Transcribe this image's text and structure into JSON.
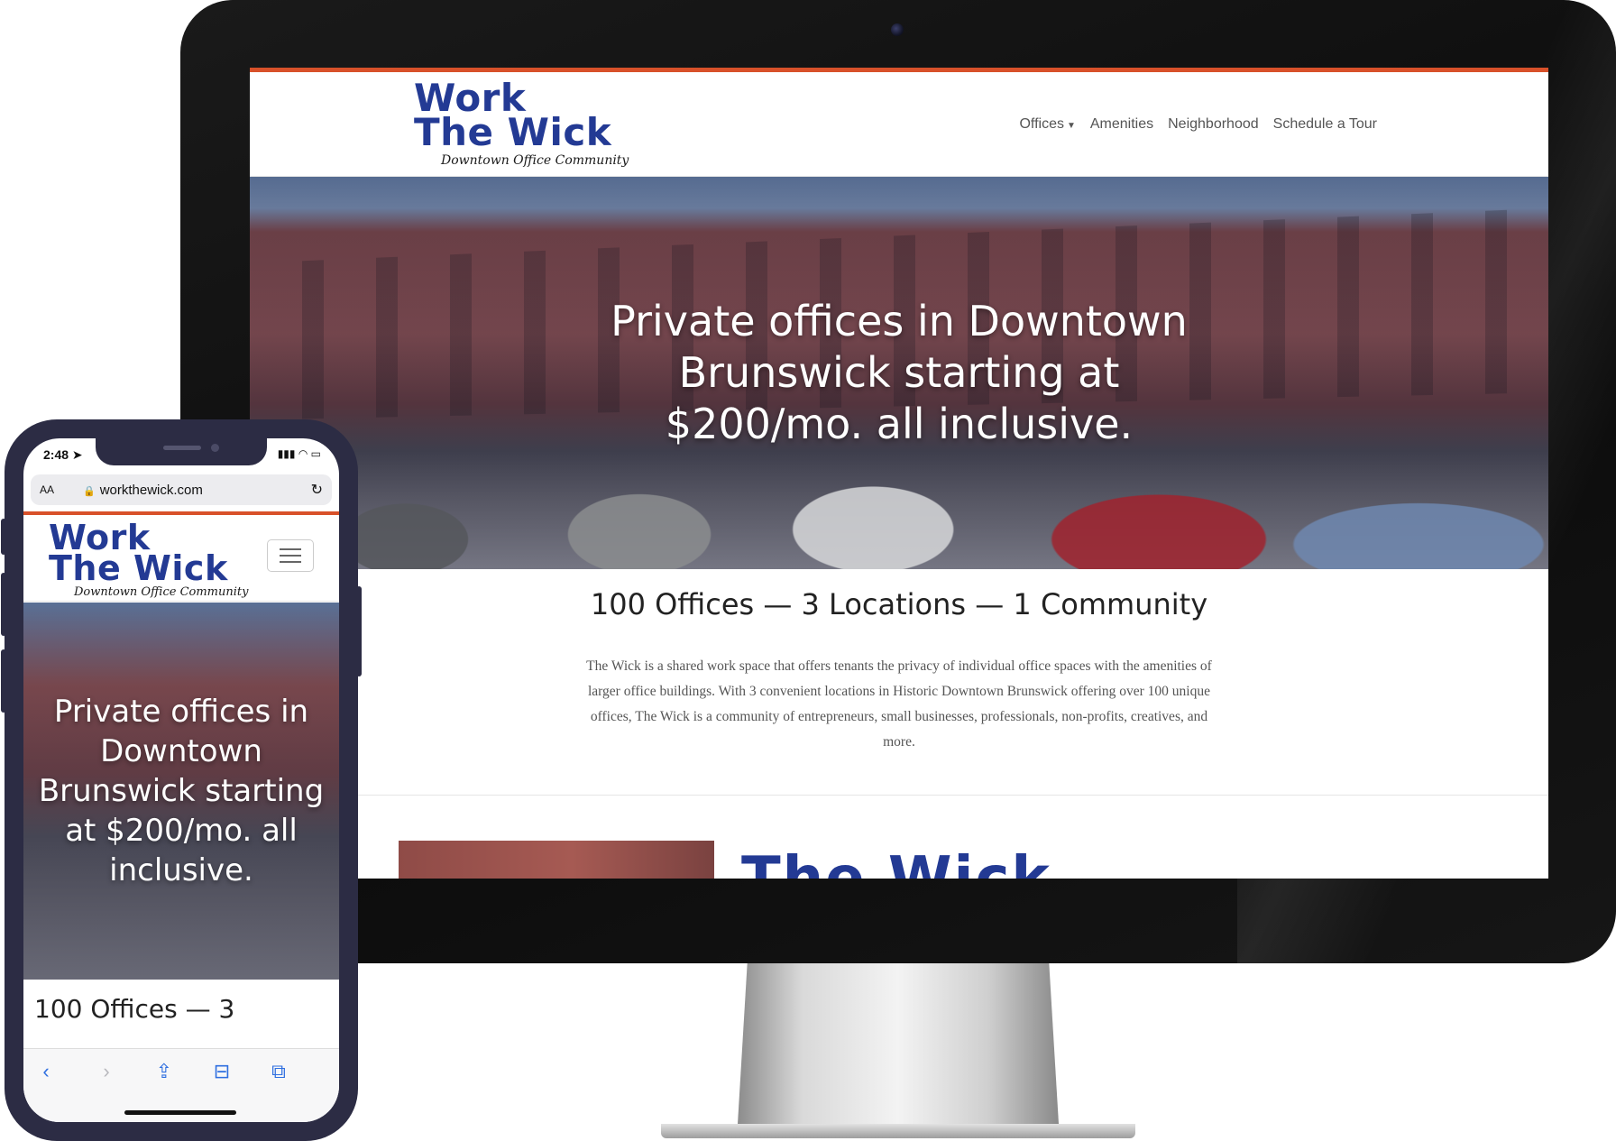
{
  "brand": {
    "logo_line1": "Work",
    "logo_line2": "The Wick",
    "logo_tagline": "Downtown Office Community",
    "accent_color": "#d8512a",
    "logo_color": "#233a94"
  },
  "desktop": {
    "nav": {
      "items": [
        {
          "label": "Offices",
          "has_dropdown": true
        },
        {
          "label": "Amenities"
        },
        {
          "label": "Neighborhood"
        },
        {
          "label": "Schedule a Tour"
        }
      ]
    },
    "hero": {
      "title": "Private offices in Downtown Brunswick starting at $200/mo. all inclusive."
    },
    "tagline": "100 Offices — 3 Locations — 1 Community",
    "intro": "The Wick is a shared work space that offers tenants the privacy of individual office spaces with the amenities of larger office buildings. With 3 convenient locations in Historic Downtown Brunswick offering over 100 unique offices, The Wick is a community of entrepreneurs, small businesses, professionals, non-profits, creatives, and more.",
    "section_logo_text": "The Wick"
  },
  "mobile": {
    "status": {
      "time": "2:48",
      "icons": "▮▮▮ ◠ ▭"
    },
    "url_bar": {
      "aa": "AA",
      "url": "workthewick.com"
    },
    "hero": {
      "title": "Private offices in Downtown Brunswick starting at $200/mo. all inclusive."
    },
    "tagline": "100 Offices — 3",
    "toolbar": {
      "back": "‹",
      "forward": "›",
      "share": "⇪",
      "bookmarks": "⊟",
      "tabs": "⧉"
    }
  }
}
